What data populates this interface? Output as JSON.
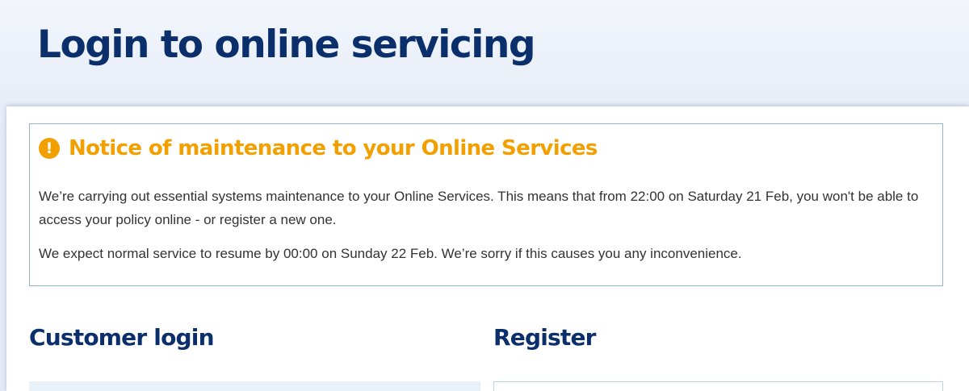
{
  "page": {
    "title": "Login to online servicing"
  },
  "notice": {
    "icon": "exclamation-circle-icon",
    "icon_glyph": "!",
    "title": "Notice of maintenance to your Online Services",
    "paragraphs": [
      "We’re carrying out essential systems maintenance to your Online Services. This means that from 22:00 on Saturday 21 Feb, you won't be able to access your policy online - or register a new one.",
      "We expect normal service to resume by 00:00 on Sunday 22 Feb. We’re sorry if this causes you any inconvenience."
    ]
  },
  "sections": {
    "customer_login": {
      "heading": "Customer login"
    },
    "register": {
      "heading": "Register"
    }
  },
  "colors": {
    "brand_navy": "#0b2f6b",
    "notice_orange": "#f29f00",
    "notice_border": "#8fb7cf",
    "body_text": "#333333"
  }
}
